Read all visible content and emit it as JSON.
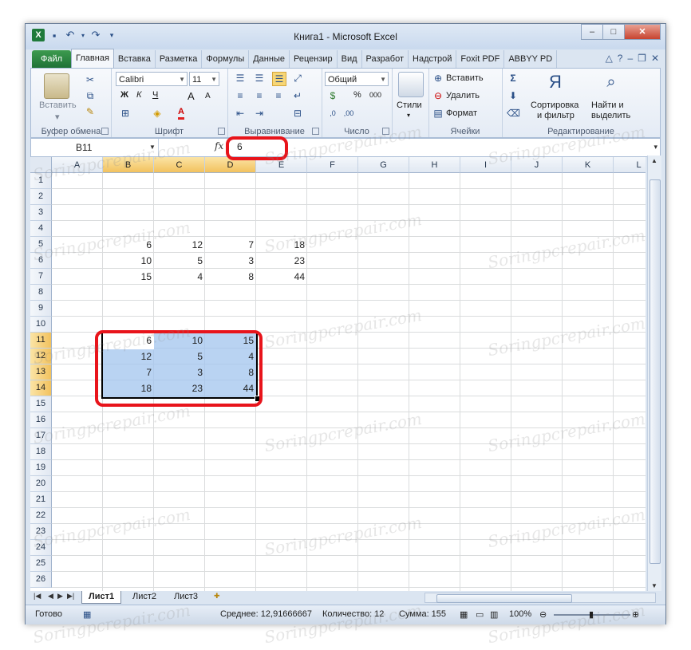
{
  "window": {
    "title": "Книга1 - Microsoft Excel",
    "min": "–",
    "max": "□",
    "close": "✕"
  },
  "tabs": [
    "Файл",
    "Главная",
    "Вставка",
    "Разметка",
    "Формулы",
    "Данные",
    "Рецензир",
    "Вид",
    "Разработ",
    "Надстрой",
    "Foxit PDF",
    "ABBYY PD"
  ],
  "ribbon": {
    "clipboard": {
      "paste": "Вставить",
      "label": "Буфер обмена"
    },
    "font": {
      "name": "Calibri",
      "size": "11",
      "bold": "Ж",
      "italic": "К",
      "underline": "Ч",
      "grow": "A",
      "shrink": "A",
      "label": "Шрифт"
    },
    "alignment": {
      "label": "Выравнивание"
    },
    "number": {
      "format": "Общий",
      "percent": "%",
      "thousands": "000",
      "label": "Число"
    },
    "styles": {
      "label": "Стили"
    },
    "cells": {
      "insert": "Вставить",
      "delete": "Удалить",
      "format": "Формат",
      "label": "Ячейки"
    },
    "editing": {
      "sort_line1": "Сортировка",
      "sort_line2": "и фильтр",
      "find_line1": "Найти и",
      "find_line2": "выделить",
      "label": "Редактирование"
    }
  },
  "formula_bar": {
    "name_box": "B11",
    "fx": "fx",
    "value": "6"
  },
  "columns": [
    "A",
    "B",
    "C",
    "D",
    "E",
    "F",
    "G",
    "H",
    "I",
    "J",
    "K",
    "L"
  ],
  "rows": [
    "1",
    "2",
    "3",
    "4",
    "5",
    "6",
    "7",
    "8",
    "9",
    "10",
    "11",
    "12",
    "13",
    "14",
    "15",
    "16",
    "17",
    "18",
    "19",
    "20",
    "21",
    "22",
    "23",
    "24",
    "25",
    "26"
  ],
  "cells": {
    "r5": [
      "6",
      "12",
      "7",
      "18"
    ],
    "r6": [
      "10",
      "5",
      "3",
      "23"
    ],
    "r7": [
      "15",
      "4",
      "8",
      "44"
    ],
    "r11": [
      "6",
      "10",
      "15"
    ],
    "r12": [
      "12",
      "5",
      "4"
    ],
    "r13": [
      "7",
      "3",
      "8"
    ],
    "r14": [
      "18",
      "23",
      "44"
    ]
  },
  "sheets": [
    "Лист1",
    "Лист2",
    "Лист3"
  ],
  "status": {
    "ready": "Готово",
    "average": "Среднее: 12,91666667",
    "count": "Количество: 12",
    "sum": "Сумма: 155",
    "zoom": "100%"
  },
  "watermark": "Soringpcrepair.com"
}
